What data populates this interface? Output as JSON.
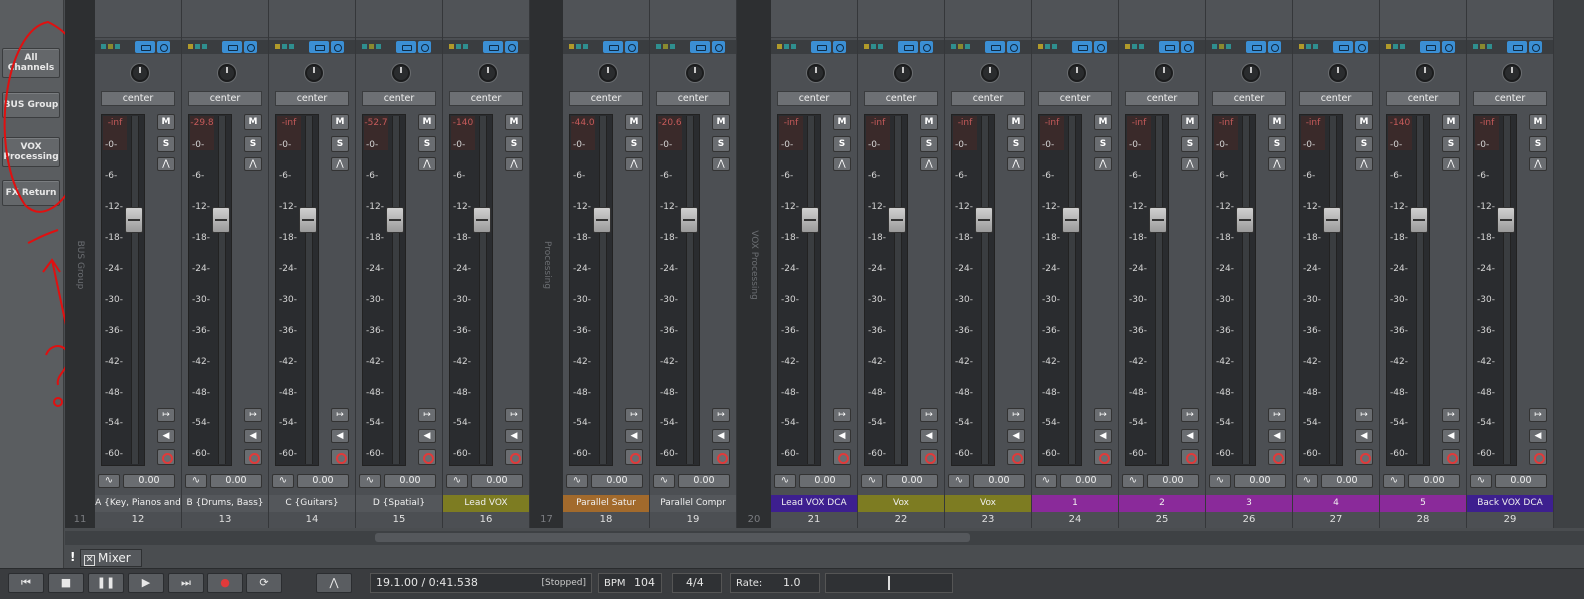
{
  "left_panel": {
    "groups": [
      {
        "label": "All Channels"
      },
      {
        "label": "BUS Group"
      },
      {
        "label": "VOX Processing"
      },
      {
        "label": "FX Return"
      }
    ]
  },
  "meter_scale": [
    "-0-",
    "-6-",
    "-12-",
    "-18-",
    "-24-",
    "-30-",
    "-36-",
    "-42-",
    "-48-",
    "-54-",
    "-60-"
  ],
  "separators": [
    {
      "label": "BUS Group",
      "number": "11"
    },
    {
      "label": "Processing",
      "number": "17"
    },
    {
      "label": "VOX Processing",
      "number": "20"
    }
  ],
  "channels": [
    {
      "number": "12",
      "name": "A {Key, Pianos and",
      "pan": "center",
      "peak": "-inf",
      "volume": "0.00",
      "name_color": "#54575b"
    },
    {
      "number": "13",
      "name": "B {Drums, Bass}",
      "pan": "center",
      "peak": "-29.8",
      "volume": "0.00",
      "name_color": "#54575b"
    },
    {
      "number": "14",
      "name": "C {Guitars}",
      "pan": "center",
      "peak": "-inf",
      "volume": "0.00",
      "name_color": "#54575b"
    },
    {
      "number": "15",
      "name": "D {Spatial}",
      "pan": "center",
      "peak": "-52.7",
      "volume": "0.00",
      "name_color": "#54575b"
    },
    {
      "number": "16",
      "name": "Lead VOX",
      "pan": "center",
      "peak": "-140",
      "volume": "0.00",
      "name_color": "#7d7c22"
    },
    {
      "number": "18",
      "name": "Parallel Satur",
      "pan": "center",
      "peak": "-44.0",
      "volume": "0.00",
      "name_color": "#a26a2c"
    },
    {
      "number": "19",
      "name": "Parallel Compr",
      "pan": "center",
      "peak": "-20.6",
      "volume": "0.00",
      "name_color": "#54575b"
    },
    {
      "number": "21",
      "name": "Lead VOX DCA",
      "pan": "center",
      "peak": "-inf",
      "volume": "0.00",
      "name_color": "#3d1f8f"
    },
    {
      "number": "22",
      "name": "Vox",
      "pan": "center",
      "peak": "-inf",
      "volume": "0.00",
      "name_color": "#7d7c22"
    },
    {
      "number": "23",
      "name": "Vox",
      "pan": "center",
      "peak": "-inf",
      "volume": "0.00",
      "name_color": "#7d7c22"
    },
    {
      "number": "24",
      "name": "1",
      "pan": "center",
      "peak": "-inf",
      "volume": "0.00",
      "name_color": "#8a2a9a"
    },
    {
      "number": "25",
      "name": "2",
      "pan": "center",
      "peak": "-inf",
      "volume": "0.00",
      "name_color": "#8a2a9a"
    },
    {
      "number": "26",
      "name": "3",
      "pan": "center",
      "peak": "-inf",
      "volume": "0.00",
      "name_color": "#8a2a9a"
    },
    {
      "number": "27",
      "name": "4",
      "pan": "center",
      "peak": "-inf",
      "volume": "0.00",
      "name_color": "#8a2a9a"
    },
    {
      "number": "28",
      "name": "5",
      "pan": "center",
      "peak": "-140",
      "volume": "0.00",
      "name_color": "#8a2a9a"
    },
    {
      "number": "29",
      "name": "Back VOX DCA",
      "pan": "center",
      "peak": "-inf",
      "volume": "0.00",
      "name_color": "#3d1f8f"
    }
  ],
  "channel_buttons": {
    "mute": "M",
    "solo": "S"
  },
  "mixer_tab": {
    "excl": "!",
    "close": "✕",
    "label": "Mixer"
  },
  "transport": {
    "rewind": "⏮",
    "stop": "■",
    "pause": "❚❚",
    "play": "▶",
    "forward": "⏭",
    "record": "●",
    "loop": "⟳",
    "auto": "⋀",
    "position": "19.1.00 / 0:41.538",
    "state": "[Stopped]",
    "bpm_label": "BPM",
    "bpm": "104",
    "time_signature": "4/4",
    "rate_label": "Rate:",
    "rate": "1.0"
  }
}
